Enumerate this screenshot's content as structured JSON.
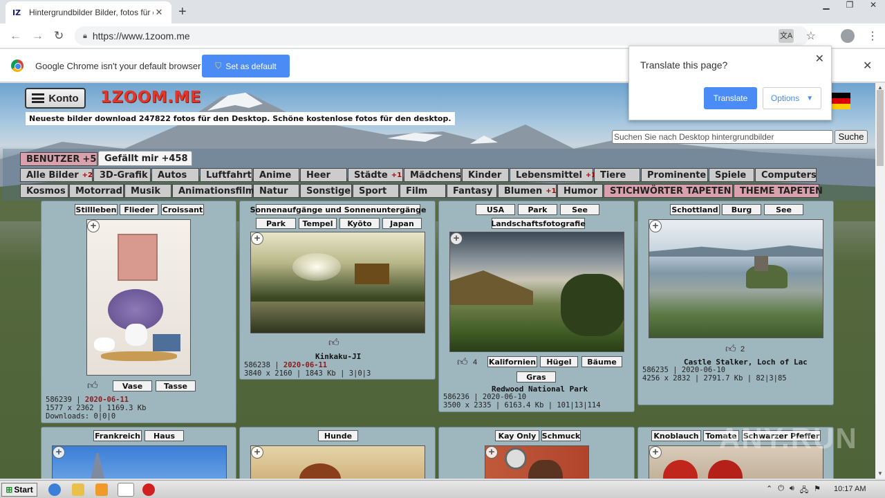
{
  "browser": {
    "tab_title": "Hintergrundbilder Bilder, fotos für de",
    "favicon_text": "IZ",
    "url": "https://www.1zoom.me",
    "infobar_message": "Google Chrome isn't your default browser",
    "set_default_label": "Set as default",
    "translate_popup": {
      "title": "Translate this page?",
      "translate_label": "Translate",
      "options_label": "Options"
    }
  },
  "site": {
    "konto_label": "Konto",
    "logo": "1ZOOM.ME",
    "tagline": "Neueste bilder download 247822 fotos für den Desktop. Schöne kostenlose fotos für den desktop.",
    "search_placeholder": "Suchen Sie nach Desktop hintergrundbilder",
    "search_button": "Suche",
    "benutzer_label": "BENUTZER",
    "benutzer_badge": "+5",
    "gefaellt_label": "Gefällt mir +458"
  },
  "categories_row1": [
    {
      "label": "Alle Bilder",
      "badge": "+2"
    },
    {
      "label": "3D-Grafik",
      "badge": ""
    },
    {
      "label": "Autos",
      "badge": ""
    },
    {
      "label": "Luftfahrt",
      "badge": ""
    },
    {
      "label": "Anime",
      "badge": ""
    },
    {
      "label": "Heer",
      "badge": ""
    },
    {
      "label": "Städte",
      "badge": "+1"
    },
    {
      "label": "Mädchens",
      "badge": ""
    },
    {
      "label": "Kinder",
      "badge": ""
    },
    {
      "label": "Lebensmittel",
      "badge": "+1"
    },
    {
      "label": "Tiere",
      "badge": ""
    },
    {
      "label": "Prominente",
      "badge": ""
    },
    {
      "label": "Spiele",
      "badge": ""
    },
    {
      "label": "Computers",
      "badge": ""
    }
  ],
  "categories_row2": [
    {
      "label": "Kosmos",
      "badge": ""
    },
    {
      "label": "Motorrad",
      "badge": ""
    },
    {
      "label": "Musik",
      "badge": ""
    },
    {
      "label": "Animationsfilm",
      "badge": ""
    },
    {
      "label": "Natur",
      "badge": ""
    },
    {
      "label": "Sonstige",
      "badge": ""
    },
    {
      "label": "Sport",
      "badge": ""
    },
    {
      "label": "Film",
      "badge": ""
    },
    {
      "label": "Fantasy",
      "badge": ""
    },
    {
      "label": "Blumen",
      "badge": "+1"
    },
    {
      "label": "Humor",
      "badge": ""
    },
    {
      "label": "STICHWÖRTER TAPETEN",
      "badge": ""
    },
    {
      "label": "THEME TAPETEN",
      "badge": ""
    }
  ],
  "cards": [
    {
      "tags_top": [
        "Stillleben",
        "Flieder",
        "Croissant"
      ],
      "tags_bottom": [
        "Vase",
        "Tasse"
      ],
      "title": "",
      "likes": "",
      "id": "586239",
      "date": "2020-06-11",
      "size": "1577 x 2362 | 1169.3 Kb",
      "extra": "Downloads: 0|0|0"
    },
    {
      "tags_top": [
        "Sonnenaufgänge und Sonnenuntergänge"
      ],
      "tags_top2": [
        "Park",
        "Tempel",
        "Kyōto",
        "Japan"
      ],
      "title": "Kinkaku-JI",
      "likes": "",
      "id": "586238",
      "date": "2020-06-11",
      "size": "3840 x 2160 | 1843 Kb | 3|0|3"
    },
    {
      "tags_top": [
        "USA",
        "Park",
        "See"
      ],
      "tags_top2": [
        "Landschaftsfotografie"
      ],
      "tags_bottom": [
        "Kalifornien",
        "Hügel",
        "Bäume"
      ],
      "tags_bottom2": [
        "Gras"
      ],
      "title": "Redwood National Park",
      "likes": "4",
      "id": "586236",
      "date": "2020-06-10",
      "size": "3500 x 2335 | 6163.4 Kb | 101|13|114"
    },
    {
      "tags_top": [
        "Schottland",
        "Burg",
        "See"
      ],
      "title": "Castle Stalker, Loch of Lac",
      "likes": "2",
      "id": "586235",
      "date": "2020-06-10",
      "size": "4256 x 2832 | 2791.7 Kb | 82|3|85"
    }
  ],
  "cards_row2_tags": [
    [
      "Frankreich",
      "Haus"
    ],
    [
      "Hunde"
    ],
    [
      "Kay Only",
      "Schmuck"
    ],
    [
      "Knoblauch",
      "Tomate",
      "Schwarzer Pfeffer"
    ]
  ],
  "taskbar": {
    "start_label": "Start",
    "clock": "10:17 AM"
  },
  "watermark": "ANY.RUN"
}
